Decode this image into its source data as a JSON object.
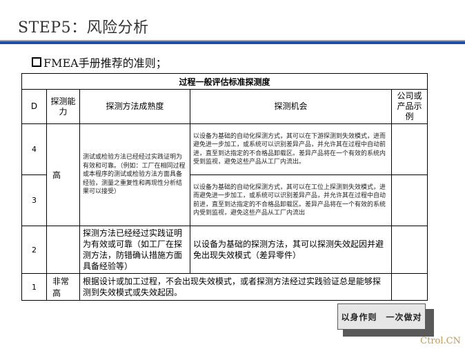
{
  "title": "STEP5：风险分析",
  "subtitle": "FMEA手册推荐的准则；",
  "table": {
    "caption": "过程一般评估标准探测度",
    "headers": {
      "d": "D",
      "ability": "探测能力",
      "method": "探测方法成熟度",
      "opportunity": "探测机会",
      "example": "公司或产品示例"
    },
    "rows": [
      {
        "d": "4",
        "ability": "高",
        "method": "测试或检验方法已经经过实践证明为有效和可靠。（例如：工厂在相同过程或本程序的测试或检验方法方面具备经验，测量之重复性和再现性分析结果可以接受）",
        "opportunity": "以设备为基础的自动化探测方式，其可以在下游探测到失效模式，进而避免进一步加工，或系统可以识别差异产品，并允许其在过程中自动前进，直至到达指定的不合格品卸载区。差异产品将在一个有效的系统内受到监视，避免这些产品从工厂内流出。",
        "example": ""
      },
      {
        "d": "3",
        "opportunity": "以设备为基础的自动化探测方式，其可以在工位上探测到失效模式，进而避免进一步加工，或系统可以识别差异产品，并允许其在过程中自动前进，直至到达指定的不合格品卸载区。差异产品将在一个有效的系统内受到监视，避免这些产品从工厂内流出",
        "example": ""
      },
      {
        "d": "2",
        "method": "探测方法已经经过实践证明为有效或可靠（如工厂在探测方法，防错确认措施方面具备经验等）",
        "opportunity": "以设备为基础的探测方法，其可以探测失效起因并避免出现失效模式（差异零件）",
        "example": ""
      },
      {
        "d": "1",
        "ability": "非常高",
        "method": "根据设计或加工过程，不会出现失效模式，或者探测方法经过实践验证总是能够探测到失效模式或失效起因。",
        "example": ""
      }
    ]
  },
  "footer_slogan": "以身作则　一次做对",
  "watermark": "Ctrol.CN"
}
